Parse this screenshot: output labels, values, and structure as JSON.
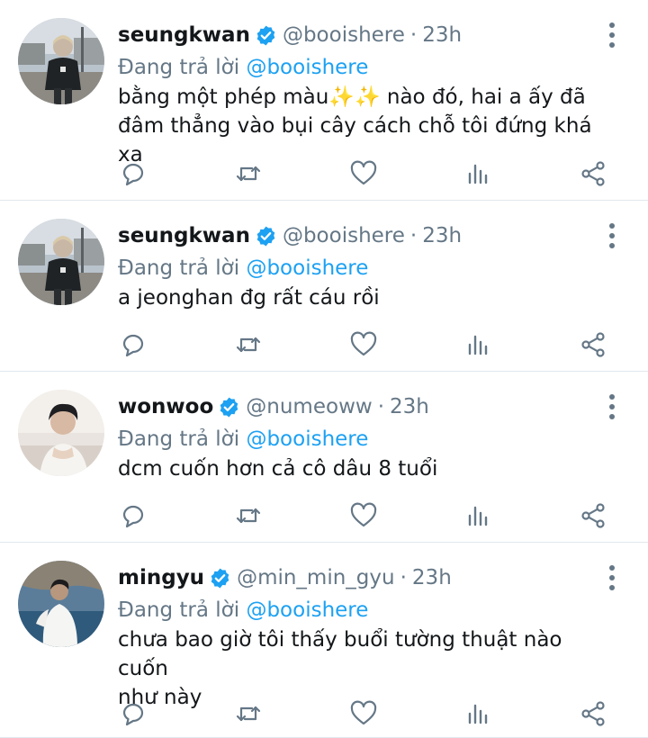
{
  "tweets": [
    {
      "name": "seungkwan",
      "handle": "@booishere",
      "separator": "·",
      "time": "23h",
      "reply_prefix": "Đang trả lời ",
      "reply_to": "@booishere",
      "text_lines": [
        "bằng một phép màu✨✨ nào đó, hai a ấy đã",
        "đâm thẳng vào bụi cây cách chỗ tôi đứng khá xa"
      ],
      "avatar_icon": "photo-person-street"
    },
    {
      "name": "seungkwan",
      "handle": "@booishere",
      "separator": "·",
      "time": "23h",
      "reply_prefix": "Đang trả lời ",
      "reply_to": "@booishere",
      "text_lines": [
        "a jeonghan đg rất cáu rồi"
      ],
      "avatar_icon": "photo-person-street"
    },
    {
      "name": "wonwoo",
      "handle": "@numeoww",
      "separator": "·",
      "time": "23h",
      "reply_prefix": "Đang trả lời ",
      "reply_to": "@booishere",
      "text_lines": [
        "dcm cuốn hơn cả cô dâu 8 tuổi"
      ],
      "avatar_icon": "photo-person-indoor"
    },
    {
      "name": "mingyu",
      "handle": "@min_min_gyu",
      "separator": "·",
      "time": "23h",
      "reply_prefix": "Đang trả lời ",
      "reply_to": "@booishere",
      "text_lines": [
        "chưa bao giờ tôi thấy buổi tường thuật nào cuốn",
        "như này"
      ],
      "avatar_icon": "photo-person-sea"
    }
  ],
  "icons": {
    "verified": "verified-badge-icon",
    "more": "more-vertical-icon",
    "reply": "reply-icon",
    "retweet": "retweet-icon",
    "like": "heart-icon",
    "stats": "stats-icon",
    "share": "share-icon"
  },
  "colors": {
    "text": "#14171a",
    "secondary": "#657786",
    "link": "#1da1f2",
    "verified": "#1da1f2",
    "divider": "#e1e8ed"
  }
}
